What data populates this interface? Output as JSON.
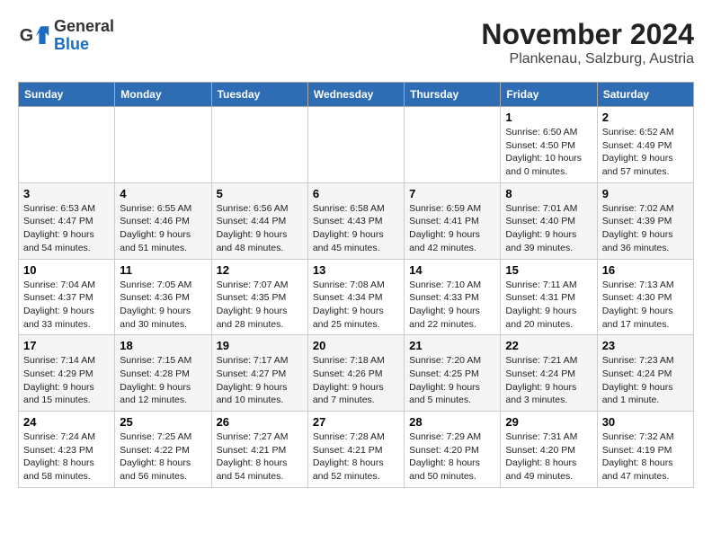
{
  "logo": {
    "general": "General",
    "blue": "Blue"
  },
  "title": "November 2024",
  "subtitle": "Plankenau, Salzburg, Austria",
  "days_header": [
    "Sunday",
    "Monday",
    "Tuesday",
    "Wednesday",
    "Thursday",
    "Friday",
    "Saturday"
  ],
  "weeks": [
    [
      {
        "day": "",
        "info": ""
      },
      {
        "day": "",
        "info": ""
      },
      {
        "day": "",
        "info": ""
      },
      {
        "day": "",
        "info": ""
      },
      {
        "day": "",
        "info": ""
      },
      {
        "day": "1",
        "info": "Sunrise: 6:50 AM\nSunset: 4:50 PM\nDaylight: 10 hours and 0 minutes."
      },
      {
        "day": "2",
        "info": "Sunrise: 6:52 AM\nSunset: 4:49 PM\nDaylight: 9 hours and 57 minutes."
      }
    ],
    [
      {
        "day": "3",
        "info": "Sunrise: 6:53 AM\nSunset: 4:47 PM\nDaylight: 9 hours and 54 minutes."
      },
      {
        "day": "4",
        "info": "Sunrise: 6:55 AM\nSunset: 4:46 PM\nDaylight: 9 hours and 51 minutes."
      },
      {
        "day": "5",
        "info": "Sunrise: 6:56 AM\nSunset: 4:44 PM\nDaylight: 9 hours and 48 minutes."
      },
      {
        "day": "6",
        "info": "Sunrise: 6:58 AM\nSunset: 4:43 PM\nDaylight: 9 hours and 45 minutes."
      },
      {
        "day": "7",
        "info": "Sunrise: 6:59 AM\nSunset: 4:41 PM\nDaylight: 9 hours and 42 minutes."
      },
      {
        "day": "8",
        "info": "Sunrise: 7:01 AM\nSunset: 4:40 PM\nDaylight: 9 hours and 39 minutes."
      },
      {
        "day": "9",
        "info": "Sunrise: 7:02 AM\nSunset: 4:39 PM\nDaylight: 9 hours and 36 minutes."
      }
    ],
    [
      {
        "day": "10",
        "info": "Sunrise: 7:04 AM\nSunset: 4:37 PM\nDaylight: 9 hours and 33 minutes."
      },
      {
        "day": "11",
        "info": "Sunrise: 7:05 AM\nSunset: 4:36 PM\nDaylight: 9 hours and 30 minutes."
      },
      {
        "day": "12",
        "info": "Sunrise: 7:07 AM\nSunset: 4:35 PM\nDaylight: 9 hours and 28 minutes."
      },
      {
        "day": "13",
        "info": "Sunrise: 7:08 AM\nSunset: 4:34 PM\nDaylight: 9 hours and 25 minutes."
      },
      {
        "day": "14",
        "info": "Sunrise: 7:10 AM\nSunset: 4:33 PM\nDaylight: 9 hours and 22 minutes."
      },
      {
        "day": "15",
        "info": "Sunrise: 7:11 AM\nSunset: 4:31 PM\nDaylight: 9 hours and 20 minutes."
      },
      {
        "day": "16",
        "info": "Sunrise: 7:13 AM\nSunset: 4:30 PM\nDaylight: 9 hours and 17 minutes."
      }
    ],
    [
      {
        "day": "17",
        "info": "Sunrise: 7:14 AM\nSunset: 4:29 PM\nDaylight: 9 hours and 15 minutes."
      },
      {
        "day": "18",
        "info": "Sunrise: 7:15 AM\nSunset: 4:28 PM\nDaylight: 9 hours and 12 minutes."
      },
      {
        "day": "19",
        "info": "Sunrise: 7:17 AM\nSunset: 4:27 PM\nDaylight: 9 hours and 10 minutes."
      },
      {
        "day": "20",
        "info": "Sunrise: 7:18 AM\nSunset: 4:26 PM\nDaylight: 9 hours and 7 minutes."
      },
      {
        "day": "21",
        "info": "Sunrise: 7:20 AM\nSunset: 4:25 PM\nDaylight: 9 hours and 5 minutes."
      },
      {
        "day": "22",
        "info": "Sunrise: 7:21 AM\nSunset: 4:24 PM\nDaylight: 9 hours and 3 minutes."
      },
      {
        "day": "23",
        "info": "Sunrise: 7:23 AM\nSunset: 4:24 PM\nDaylight: 9 hours and 1 minute."
      }
    ],
    [
      {
        "day": "24",
        "info": "Sunrise: 7:24 AM\nSunset: 4:23 PM\nDaylight: 8 hours and 58 minutes."
      },
      {
        "day": "25",
        "info": "Sunrise: 7:25 AM\nSunset: 4:22 PM\nDaylight: 8 hours and 56 minutes."
      },
      {
        "day": "26",
        "info": "Sunrise: 7:27 AM\nSunset: 4:21 PM\nDaylight: 8 hours and 54 minutes."
      },
      {
        "day": "27",
        "info": "Sunrise: 7:28 AM\nSunset: 4:21 PM\nDaylight: 8 hours and 52 minutes."
      },
      {
        "day": "28",
        "info": "Sunrise: 7:29 AM\nSunset: 4:20 PM\nDaylight: 8 hours and 50 minutes."
      },
      {
        "day": "29",
        "info": "Sunrise: 7:31 AM\nSunset: 4:20 PM\nDaylight: 8 hours and 49 minutes."
      },
      {
        "day": "30",
        "info": "Sunrise: 7:32 AM\nSunset: 4:19 PM\nDaylight: 8 hours and 47 minutes."
      }
    ]
  ]
}
